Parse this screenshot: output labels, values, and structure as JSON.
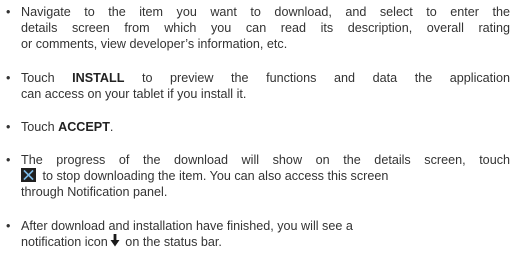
{
  "bullet": "•",
  "items": [
    {
      "lines": [
        "Navigate to the item you want to download, and select to enter the",
        "details screen from which you can read its description, overall rating",
        "or comments, view developer’s information, etc."
      ]
    },
    {
      "line1_pre": "Touch ",
      "line1_bold": "INSTALL",
      "line1_post": " to preview the functions and data the application",
      "line2": "can access on your tablet if you install it."
    },
    {
      "pre": "Touch ",
      "bold": "ACCEPT",
      "post": "."
    },
    {
      "line1": "The progress of the download will show on the details screen, touch",
      "line2_post": " to stop downloading the item. You can also access this screen",
      "line3": "through Notification panel.",
      "stop_icon": "stop-download-icon"
    },
    {
      "line1": "After download and installation have finished, you will see a",
      "line2_pre": "notification icon",
      "line2_post": " on the status bar.",
      "notify_icon": "download-arrow-icon"
    }
  ]
}
